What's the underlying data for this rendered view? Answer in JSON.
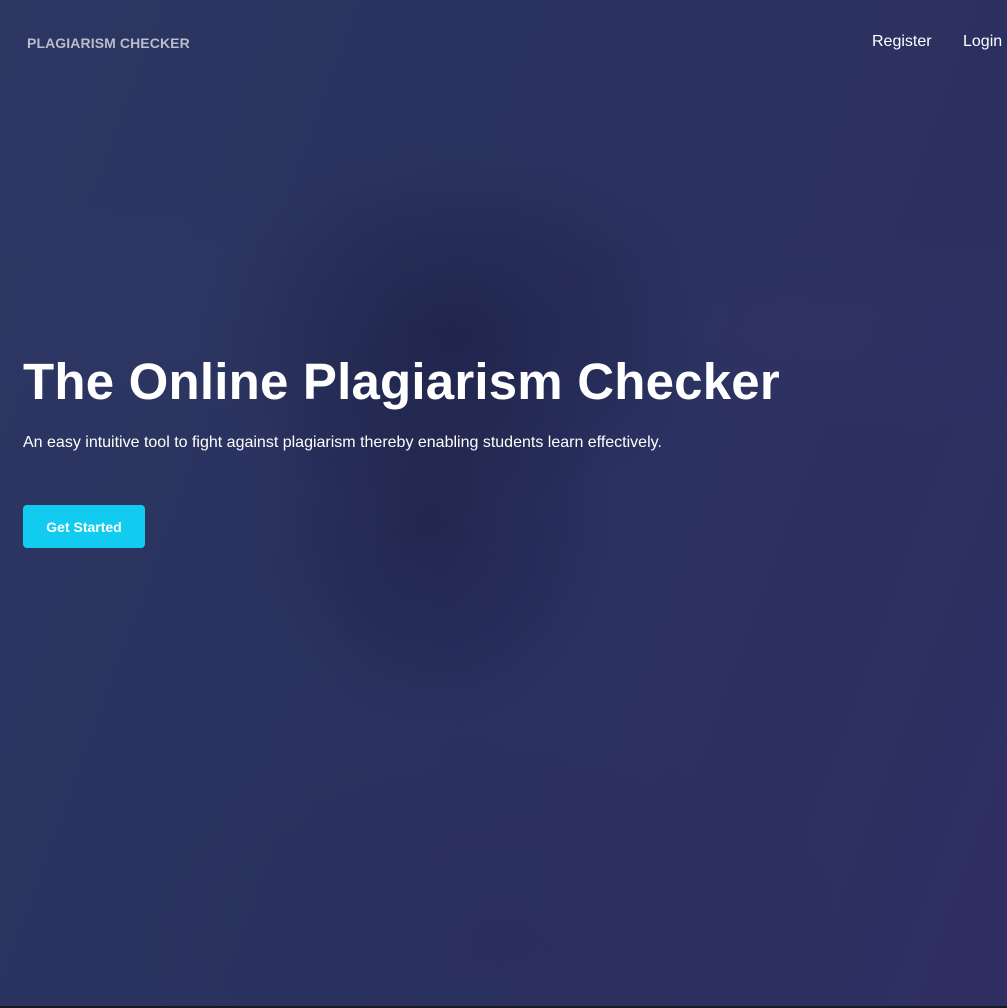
{
  "navbar": {
    "brand": "PLAGIARISM CHECKER",
    "links": [
      {
        "label": "Register"
      },
      {
        "label": "Login"
      }
    ]
  },
  "hero": {
    "title": "The Online Plagiarism Checker",
    "subtitle": "An easy intuitive tool to fight against plagiarism thereby enabling students learn effectively.",
    "cta_label": "Get Started",
    "background_image": "curly-haired-woman-photo",
    "overlay_color": "#2c3460"
  },
  "colors": {
    "accent": "#11cbf0",
    "brand_text": "#b9bccb",
    "text": "#ffffff"
  }
}
